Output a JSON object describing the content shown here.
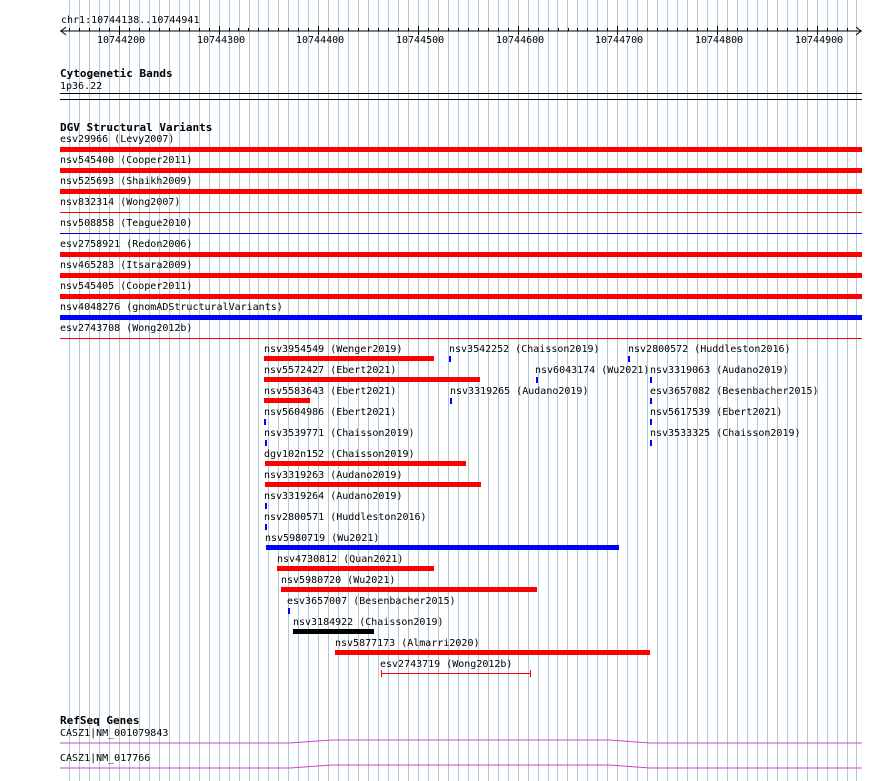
{
  "ruler": {
    "position_label": "chr1:10744138..10744941",
    "ticks": [
      "10744200",
      "10744300",
      "10744400",
      "10744500",
      "10744600",
      "10744700",
      "10744800",
      "10744900"
    ]
  },
  "cytobands": {
    "title": "Cytogenetic Bands",
    "band": "1p36.22"
  },
  "dgv": {
    "title": "DGV Structural Variants",
    "full_rows": [
      {
        "label": "esv29966 (Levy2007)",
        "color": "#ff0000",
        "style": "thick"
      },
      {
        "label": "nsv545400 (Cooper2011)",
        "color": "#ff0000",
        "style": "thick"
      },
      {
        "label": "nsv525693 (Shaikh2009)",
        "color": "#ff0000",
        "style": "thick"
      },
      {
        "label": "nsv832314 (Wong2007)",
        "color": "#ff0000",
        "style": "thin"
      },
      {
        "label": "nsv508858 (Teague2010)",
        "color": "#0000cc",
        "style": "thin"
      },
      {
        "label": "esv2758921 (Redon2006)",
        "color": "#ff0000",
        "style": "thick"
      },
      {
        "label": "nsv465283 (Itsara2009)",
        "color": "#ff0000",
        "style": "thick"
      },
      {
        "label": "nsv545405 (Cooper2011)",
        "color": "#ff0000",
        "style": "thick"
      },
      {
        "label": "nsv4048276 (gnomADStructuralVariants)",
        "color": "#0000ff",
        "style": "thick"
      },
      {
        "label": "esv2743708 (Wong2012b)",
        "color": "#ff0000",
        "style": "thin"
      }
    ],
    "features": [
      {
        "label": "nsv3954549 (Wenger2019)",
        "color": "#ff0000"
      },
      {
        "label": "nsv3542252 (Chaisson2019)",
        "color": "#0000ff"
      },
      {
        "label": "nsv2800572 (Huddleston2016)",
        "color": "#0000ff"
      },
      {
        "label": "nsv5572427 (Ebert2021)",
        "color": "#ff0000"
      },
      {
        "label": "nsv6043174 (Wu2021)",
        "color": "#0000ff"
      },
      {
        "label": "nsv3319063 (Audano2019)",
        "color": "#0000ff"
      },
      {
        "label": "nsv5583643 (Ebert2021)",
        "color": "#ff0000"
      },
      {
        "label": "nsv3319265 (Audano2019)",
        "color": "#0000ff"
      },
      {
        "label": "esv3657082 (Besenbacher2015)",
        "color": "#0000ff"
      },
      {
        "label": "nsv5604986 (Ebert2021)",
        "color": "#0000ff"
      },
      {
        "label": "nsv5617539 (Ebert2021)",
        "color": "#0000ff"
      },
      {
        "label": "nsv3539771 (Chaisson2019)",
        "color": "#0000ff"
      },
      {
        "label": "nsv3533325 (Chaisson2019)",
        "color": "#0000ff"
      },
      {
        "label": "dgv102n152 (Chaisson2019)",
        "color": "#ff0000"
      },
      {
        "label": "nsv3319263 (Audano2019)",
        "color": "#ff0000"
      },
      {
        "label": "nsv3319264 (Audano2019)",
        "color": "#0000ff"
      },
      {
        "label": "nsv2800571 (Huddleston2016)",
        "color": "#0000ff"
      },
      {
        "label": "nsv5980719 (Wu2021)",
        "color": "#0000ff"
      },
      {
        "label": "nsv4730812 (Quan2021)",
        "color": "#ff0000"
      },
      {
        "label": "nsv5980720 (Wu2021)",
        "color": "#ff0000"
      },
      {
        "label": "esv3657007 (Besenbacher2015)",
        "color": "#0000ff"
      },
      {
        "label": "nsv3184922 (Chaisson2019)",
        "color": "#000000"
      },
      {
        "label": "nsv5877173 (Almarri2020)",
        "color": "#ff0000"
      },
      {
        "label": "esv2743719 (Wong2012b)",
        "color": "#ff0000"
      }
    ]
  },
  "refseq": {
    "title": "RefSeq Genes",
    "genes": [
      {
        "label": "CASZ1|NM_001079843",
        "color": "#cc44cc"
      },
      {
        "label": "CASZ1|NM_017766",
        "color": "#cc44cc"
      }
    ]
  },
  "colors": {
    "gridline": "#aaccdd",
    "loss": "#ff0000",
    "gain": "#0000ff",
    "complex": "#000000",
    "gene": "#cc44cc"
  }
}
